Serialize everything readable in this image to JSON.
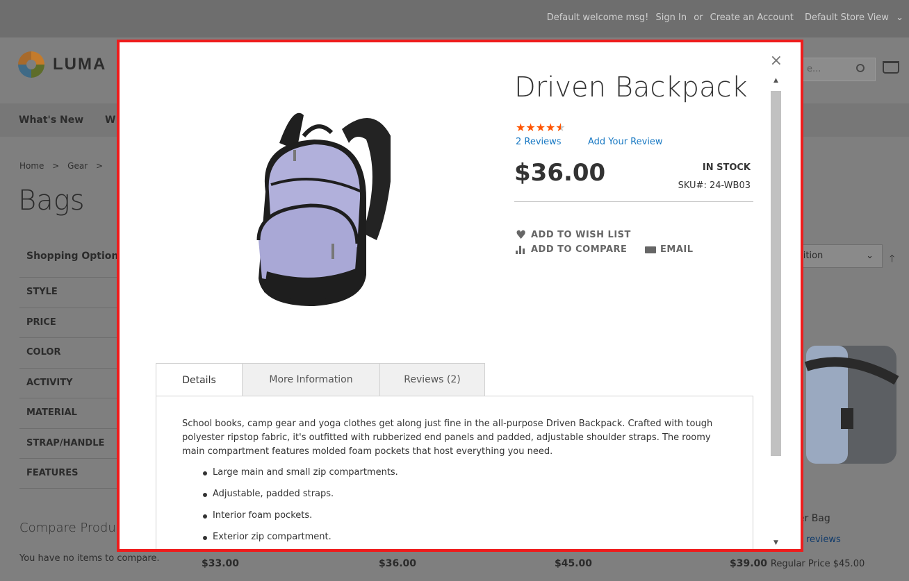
{
  "topbar": {
    "welcome": "Default welcome msg!",
    "sign_in": "Sign In",
    "or": "or",
    "create_account": "Create an Account",
    "store_view": "Default Store View"
  },
  "header": {
    "logo_text": "LUMA",
    "search_placeholder": "e..."
  },
  "nav": {
    "items": [
      "What's New",
      "W"
    ]
  },
  "breadcrumb": {
    "home": "Home",
    "sep": ">",
    "gear": "Gear"
  },
  "page": {
    "title": "Bags",
    "shopping_options": "Shopping Options",
    "filters": [
      "STYLE",
      "PRICE",
      "COLOR",
      "ACTIVITY",
      "MATERIAL",
      "STRAP/HANDLE",
      "FEATURES"
    ],
    "compare_title": "Compare Produ",
    "compare_empty": "You have no items to compare.",
    "sort_value": "sition",
    "prices": [
      "$33.00",
      "$36.00",
      "$45.00",
      "$39.00"
    ],
    "regular_price_label": "Regular Price $45.00",
    "bag_name": "ger Bag",
    "bag_reviews": "reviews"
  },
  "modal": {
    "close_glyph": "×",
    "product_title": "Driven Backpack",
    "rating_fraction": 0.9,
    "reviews_link": "2 Reviews",
    "add_review_link": "Add Your Review",
    "price": "$36.00",
    "stock": "IN STOCK",
    "sku": "SKU#:  24-WB03",
    "actions": {
      "wish": "ADD TO WISH LIST",
      "compare": "ADD TO COMPARE",
      "email": "EMAIL"
    },
    "tabs": [
      "Details",
      "More Information",
      "Reviews (2)"
    ],
    "description": "School books, camp gear and yoga clothes get along just fine in the all-purpose Driven Backpack. Crafted with tough polyester ripstop fabric, it's outfitted with rubberized end panels and padded, adjustable shoulder straps. The roomy main compartment features molded foam pockets that host everything you need.",
    "bullets": [
      "Large main and small zip compartments.",
      "Adjustable, padded straps.",
      "Interior foam pockets.",
      "Exterior zip compartment."
    ]
  },
  "colors": {
    "accent_link": "#1979c3",
    "star": "#ff5501",
    "modal_border": "#ee1c1c",
    "overlay_bg": "#7f7f7f"
  }
}
